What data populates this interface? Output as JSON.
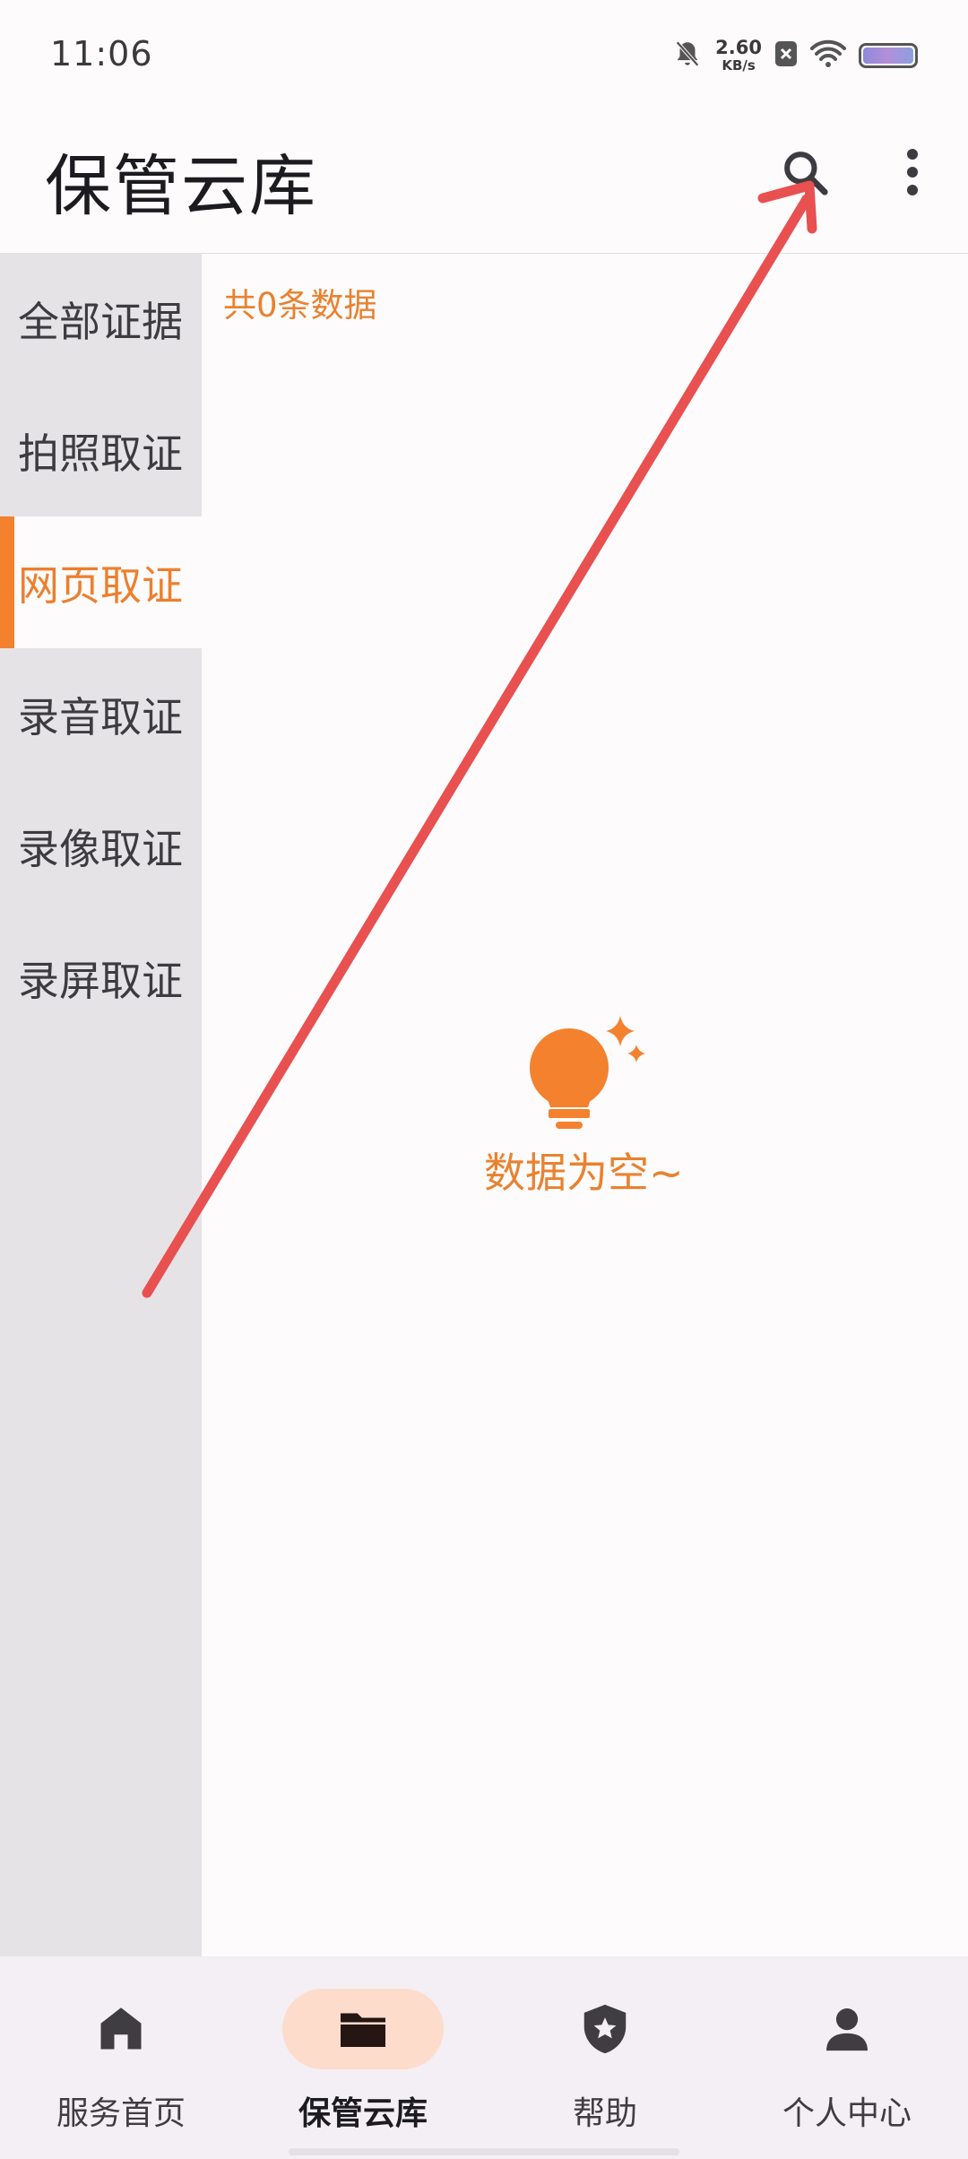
{
  "status_bar": {
    "time": "11:06",
    "net_speed_value": "2.60",
    "net_speed_unit": "KB/s"
  },
  "app_bar": {
    "title": "保管云库",
    "search_icon": "search-icon",
    "more_icon": "more-vert-icon"
  },
  "sidebar": {
    "items": [
      {
        "label": "全部证据"
      },
      {
        "label": "拍照取证"
      },
      {
        "label": "网页取证",
        "active": true
      },
      {
        "label": "录音取证"
      },
      {
        "label": "录像取证"
      },
      {
        "label": "录屏取证"
      }
    ]
  },
  "content": {
    "count_text": "共0条数据",
    "empty_text": "数据为空~",
    "empty_icon": "lightbulb-sparkle-icon"
  },
  "bottom_nav": {
    "items": [
      {
        "label": "服务首页",
        "icon": "home-icon"
      },
      {
        "label": "保管云库",
        "icon": "folder-icon",
        "active": true
      },
      {
        "label": "帮助",
        "icon": "shield-star-icon"
      },
      {
        "label": "个人中心",
        "icon": "person-icon"
      }
    ]
  },
  "colors": {
    "accent": "#f4812e",
    "accent_text": "#e9822f",
    "sidebar_bg": "#e6e3e7",
    "nav_pill": "#fedccc",
    "arrow": "#e95050"
  }
}
